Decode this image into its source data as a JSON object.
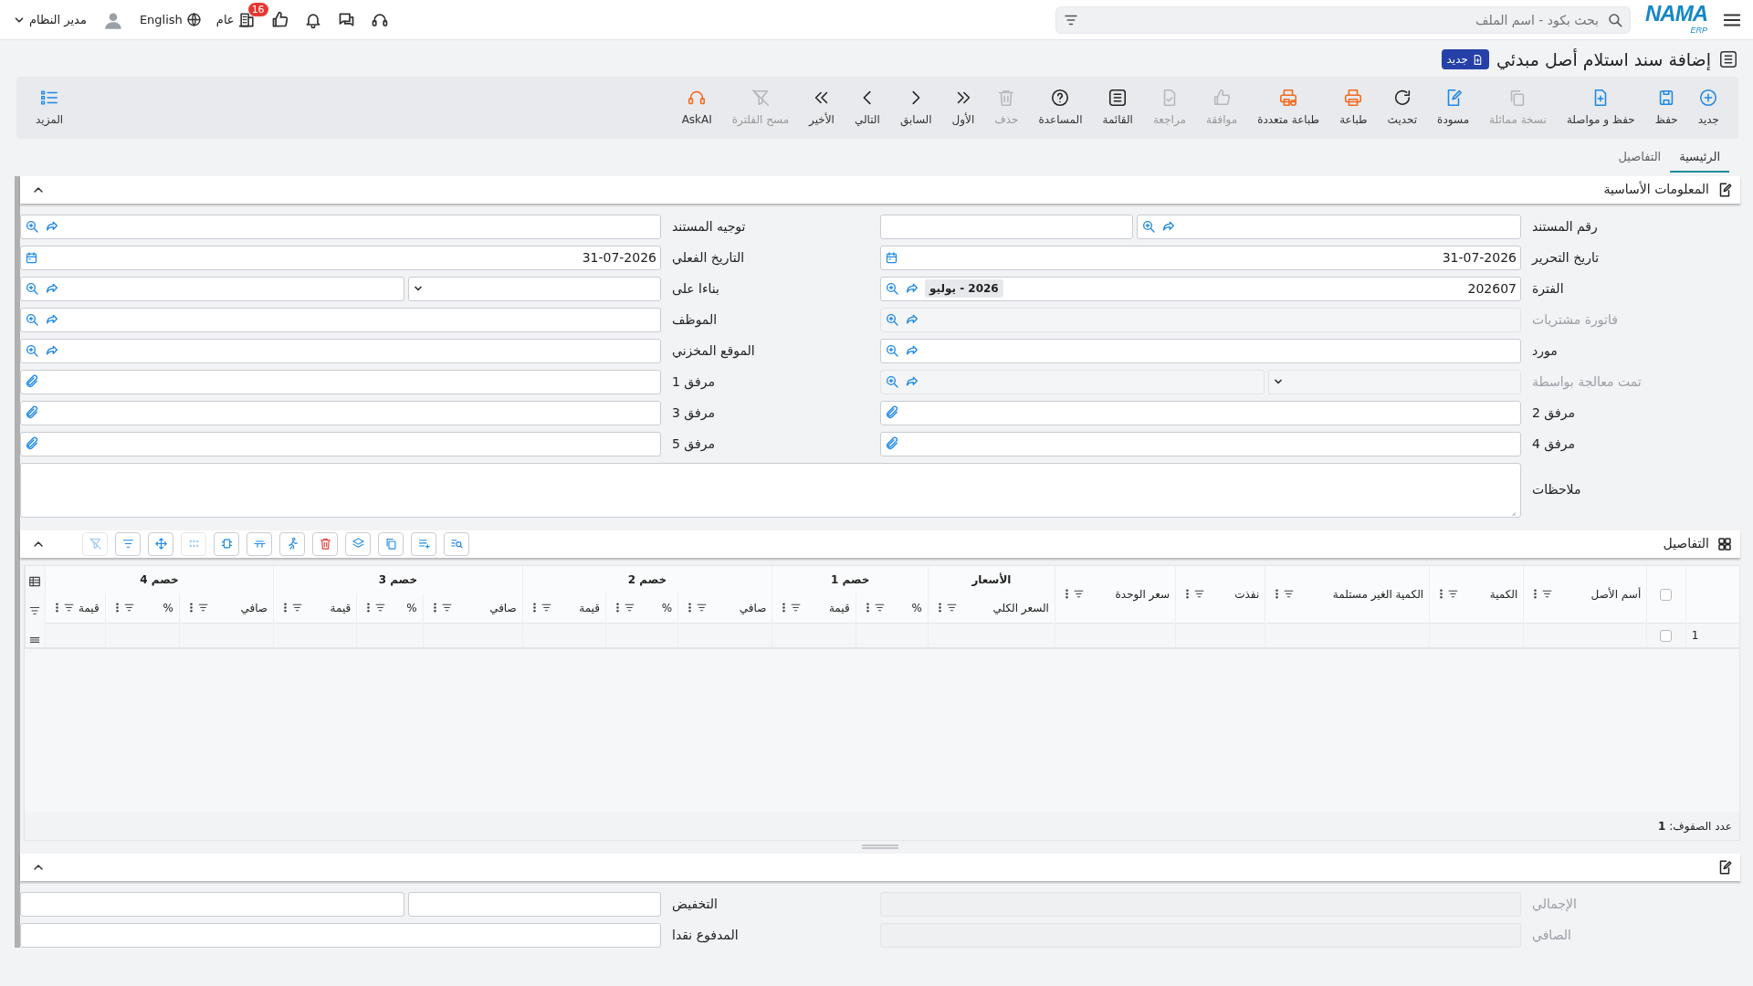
{
  "topbar": {
    "logo": "NAMA",
    "logo_sub": "ERP",
    "search": {
      "placeholder": "بحث بكود - اسم الملف"
    },
    "notification_count": "16",
    "branch": "عام",
    "language": "English",
    "user": "مدير النظام"
  },
  "page": {
    "title": "إضافة سند استلام أصل مبدئي",
    "status": "جديد"
  },
  "toolbar": [
    {
      "label": "جديد",
      "disabled": false
    },
    {
      "label": "حفظ",
      "disabled": false
    },
    {
      "label": "حفظ و مواصلة",
      "disabled": false
    },
    {
      "label": "نسخة مماثلة",
      "disabled": true
    },
    {
      "label": "مسودة",
      "disabled": false
    },
    {
      "label": "تحديث",
      "disabled": false
    },
    {
      "label": "طباعة",
      "disabled": false
    },
    {
      "label": "طباعة متعددة",
      "disabled": false
    },
    {
      "label": "موافقة",
      "disabled": true
    },
    {
      "label": "مراجعة",
      "disabled": true
    },
    {
      "label": "القائمة",
      "disabled": false
    },
    {
      "label": "المساعدة",
      "disabled": false
    },
    {
      "label": "حذف",
      "disabled": true
    },
    {
      "label": "الأول",
      "disabled": false
    },
    {
      "label": "السابق",
      "disabled": false
    },
    {
      "label": "التالي",
      "disabled": false
    },
    {
      "label": "الأخير",
      "disabled": false
    },
    {
      "label": "مسح الفلترة",
      "disabled": true
    },
    {
      "label": "AskAI",
      "disabled": false
    }
  ],
  "more": "المزيد",
  "tabs": [
    {
      "label": "الرئيسية",
      "selected": true
    },
    {
      "label": "التفاصيل",
      "selected": false
    }
  ],
  "basic_section": {
    "title": "المعلومات الأساسية",
    "expanded": true,
    "fields": [
      {
        "label": "رقم المستند",
        "kind": "lookup-extra",
        "disabled": false
      },
      {
        "label": "توجيه المستند",
        "kind": "lookup",
        "disabled": false
      },
      {
        "label": "تاريخ التحرير",
        "kind": "date",
        "value": "31-07-2026",
        "disabled": false
      },
      {
        "label": "التاريخ الفعلي",
        "kind": "date",
        "value": "31-07-2026",
        "disabled": false
      },
      {
        "label": "الفترة",
        "kind": "lookup",
        "value": "202607",
        "chip": "2026 - يوليو",
        "disabled": false
      },
      {
        "label": "بناءا على",
        "kind": "select-lookup",
        "disabled": false
      },
      {
        "label": "فاتورة مشتريات",
        "kind": "lookup",
        "disabled": true
      },
      {
        "label": "الموظف",
        "kind": "lookup",
        "disabled": false
      },
      {
        "label": "مورد",
        "kind": "lookup",
        "disabled": false
      },
      {
        "label": "الموقع المخزني",
        "kind": "lookup",
        "disabled": false
      },
      {
        "label": "تمت معالجة بواسطة",
        "kind": "select-lookup",
        "disabled": true
      },
      {
        "label": "مرفق 1",
        "kind": "attach",
        "disabled": false
      },
      {
        "label": "مرفق 2",
        "kind": "attach",
        "disabled": false
      },
      {
        "label": "مرفق 3",
        "kind": "attach",
        "disabled": false
      },
      {
        "label": "مرفق 4",
        "kind": "attach",
        "disabled": false
      },
      {
        "label": "مرفق 5",
        "kind": "attach",
        "disabled": false
      },
      {
        "label": "ملاحظات",
        "kind": "textarea",
        "disabled": false
      }
    ]
  },
  "details_section": {
    "title": "التفاصيل",
    "expanded": true,
    "tools": [
      {
        "disabled": false
      },
      {
        "disabled": false
      },
      {
        "disabled": false
      },
      {
        "disabled": false
      },
      {
        "disabled": false
      },
      {
        "disabled": false
      },
      {
        "disabled": false
      },
      {
        "disabled": false
      },
      {
        "disabled": true
      },
      {
        "disabled": false
      },
      {
        "disabled": false
      },
      {
        "disabled": true
      }
    ],
    "table": {
      "header_checked": false,
      "columns": [
        {
          "label": "أسم الأصل"
        },
        {
          "label": "الكمية"
        },
        {
          "label": "الكمية الغير مستلمة"
        },
        {
          "label": "نفذت"
        },
        {
          "label": "سعر الوحدة"
        }
      ],
      "column_groups": [
        {
          "label": "الأسعار",
          "columns": [
            {
              "label": "السعر الكلي"
            }
          ]
        },
        {
          "label": "خصم 1",
          "columns": [
            {
              "label": "%"
            },
            {
              "label": "قيمة"
            }
          ]
        },
        {
          "label": "خصم 2",
          "columns": [
            {
              "label": "صافي"
            },
            {
              "label": "%"
            },
            {
              "label": "قيمة"
            }
          ]
        },
        {
          "label": "خصم 3",
          "columns": [
            {
              "label": "صافي"
            },
            {
              "label": "%"
            },
            {
              "label": "قيمة"
            }
          ]
        },
        {
          "label": "خصم 4",
          "columns": [
            {
              "label": "صافي"
            },
            {
              "label": "%"
            },
            {
              "label": "قيمة"
            }
          ]
        }
      ],
      "rows": [
        {
          "number": "1",
          "checked": false
        }
      ]
    },
    "row_count": "عدد الصفوف: **1**"
  },
  "totals_section": {
    "expanded": true,
    "fields": [
      {
        "label": "الإجمالي",
        "kind": "readonly",
        "disabled": true
      },
      {
        "label": "التخفيض",
        "kind": "double",
        "disabled": false
      },
      {
        "label": "الصافي",
        "kind": "readonly",
        "disabled": true
      },
      {
        "label": "المدفوع نقدا",
        "kind": "text",
        "disabled": false
      }
    ]
  }
}
